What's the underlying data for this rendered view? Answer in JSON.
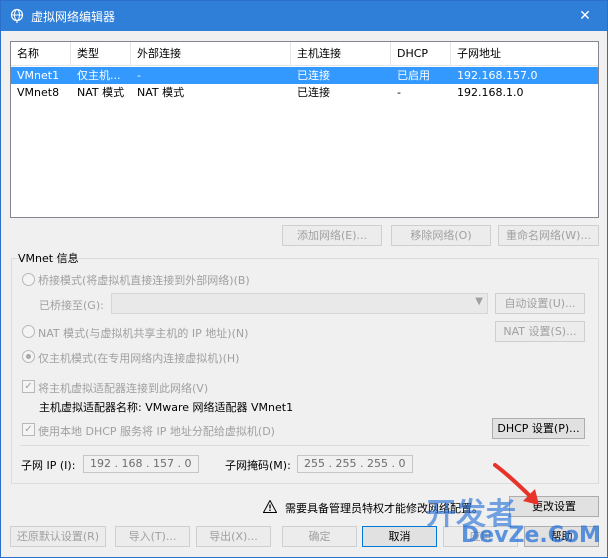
{
  "window": {
    "title": "虚拟网络编辑器",
    "close": "✕"
  },
  "table": {
    "columns": [
      "名称",
      "类型",
      "外部连接",
      "主机连接",
      "DHCP",
      "子网地址"
    ],
    "rows": [
      [
        "VMnet1",
        "仅主机...",
        "-",
        "已连接",
        "已启用",
        "192.168.157.0"
      ],
      [
        "VMnet8",
        "NAT 模式",
        "NAT 模式",
        "已连接",
        "-",
        "192.168.1.0"
      ]
    ]
  },
  "table_buttons": {
    "add": "添加网络(E)...",
    "remove": "移除网络(O)",
    "rename": "重命名网络(W)..."
  },
  "vmnet_info": {
    "label": "VMnet 信息",
    "bridge_mode": "桥接模式(将虚拟机直接连接到外部网络)(B)",
    "bridged_to": "已桥接至(G):",
    "bridged_to_value": "",
    "auto_settings": "自动设置(U)...",
    "nat_mode": "NAT 模式(与虚拟机共享主机的 IP 地址)(N)",
    "nat_settings": "NAT 设置(S)...",
    "host_only": "仅主机模式(在专用网络内连接虚拟机)(H)",
    "connect_adapter": "将主机虚拟适配器连接到此网络(V)",
    "adapter_name": "主机虚拟适配器名称: VMware 网络适配器 VMnet1",
    "use_dhcp": "使用本地 DHCP 服务将 IP 地址分配给虚拟机(D)",
    "dhcp_settings": "DHCP 设置(P)...",
    "subnet_ip_label": "子网 IP (I):",
    "subnet_ip_value": "192 . 168 . 157 . 0",
    "subnet_mask_label": "子网掩码(M):",
    "subnet_mask_value": "255 . 255 . 255 . 0"
  },
  "warning": {
    "icon": "warning-icon",
    "text": "需要具备管理员特权才能修改网络配置。",
    "change_settings": "更改设置"
  },
  "footer_buttons": {
    "restore": "还原默认设置(R)",
    "import": "导入(T)...",
    "export": "导出(X)...",
    "ok": "确定",
    "cancel": "取消",
    "apply": "应用",
    "help": "帮助"
  },
  "watermark": {
    "logo": "开发者",
    "sub": "DevZe.CoM"
  },
  "colors": {
    "titlebar": "#2f7fd8",
    "selection": "#3399ff",
    "arrow": "#e8332a"
  }
}
